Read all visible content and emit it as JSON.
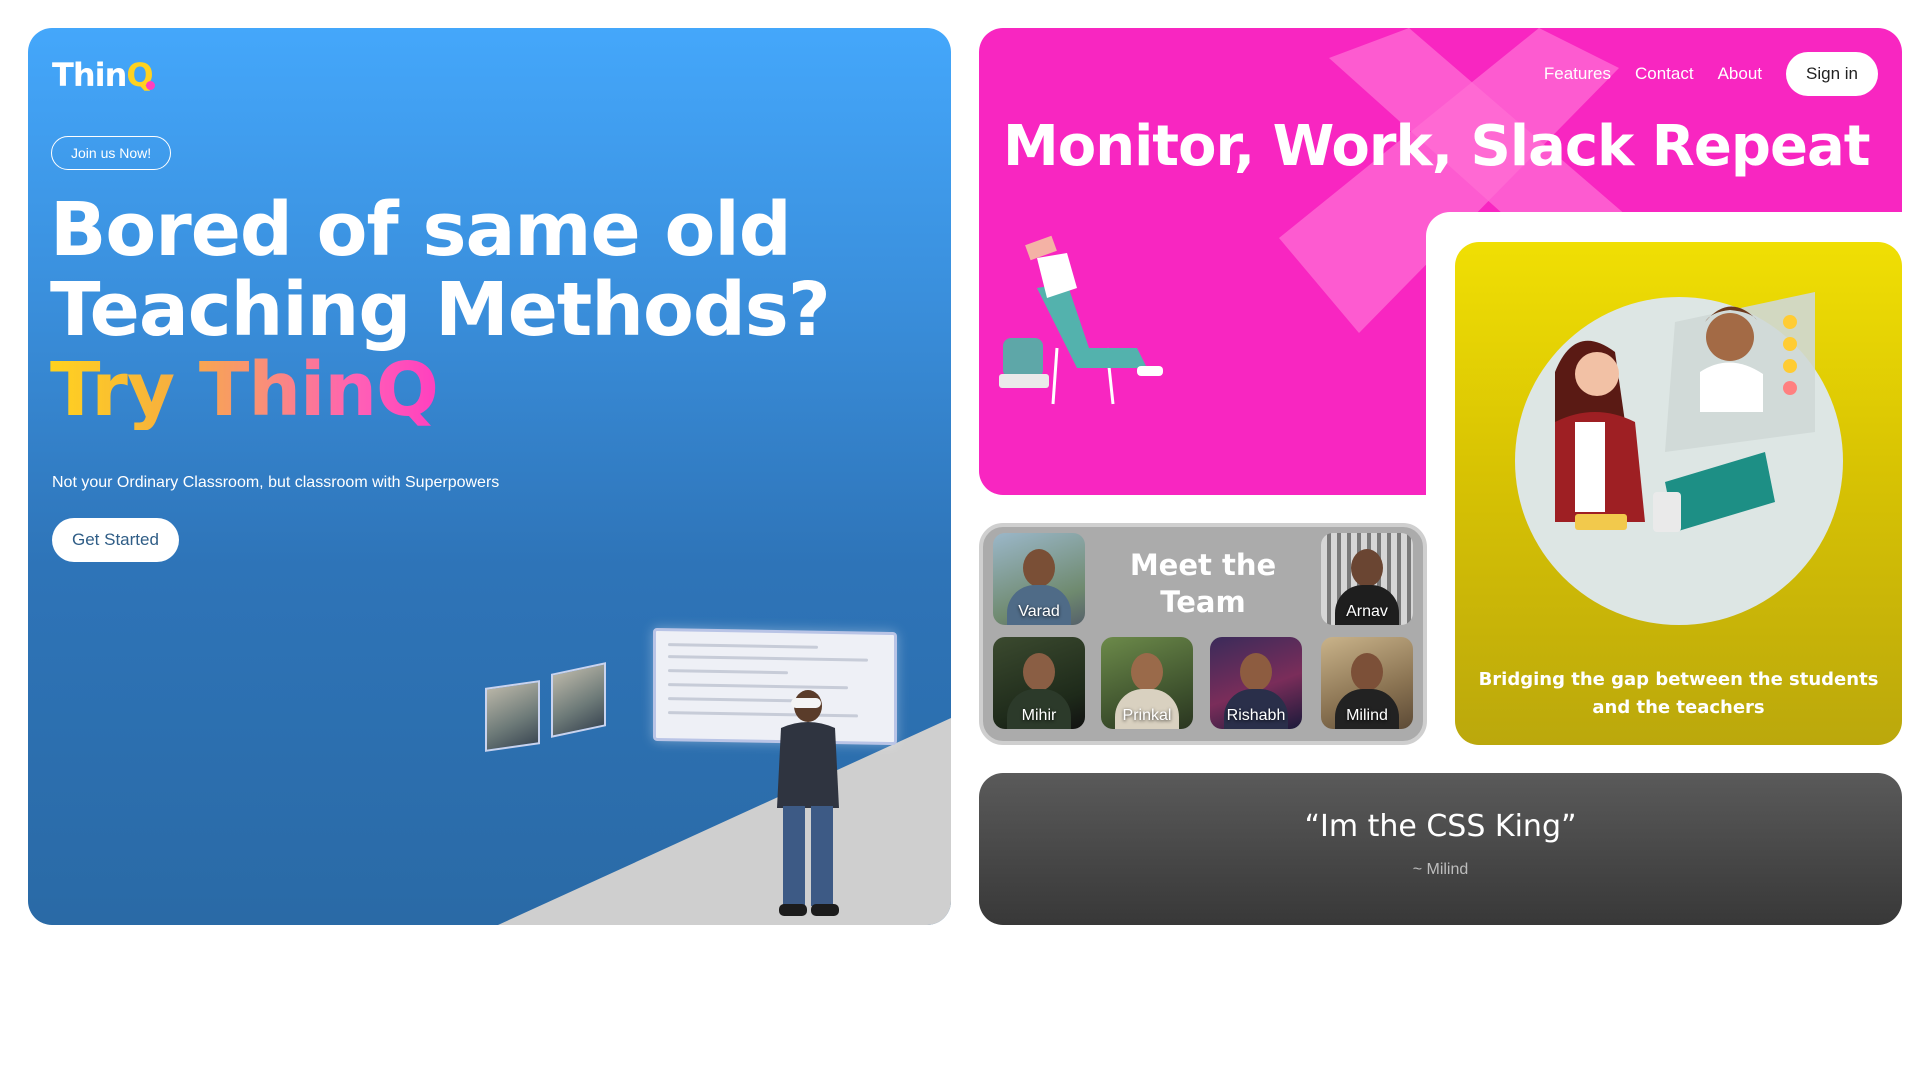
{
  "brand": {
    "logo_main": "Thin",
    "logo_q": "Q"
  },
  "hero": {
    "join_label": "Join us Now!",
    "title_line1": "Bored of same old",
    "title_line2": "Teaching Methods?",
    "try_text": "Try ThinQ",
    "subtitle": "Not your Ordinary Classroom, but classroom with Superpowers",
    "cta_label": "Get Started",
    "colors": {
      "gradient_top": "#44a7fb",
      "gradient_bottom": "#2a6aa6",
      "floor": "#cfcfcf"
    }
  },
  "nav": {
    "links": [
      "Features",
      "Contact",
      "About"
    ],
    "signin_label": "Sign in"
  },
  "magenta_card": {
    "title": "Monitor, Work, Slack Repeat",
    "color": "#f826c1"
  },
  "yellow_card": {
    "caption": "Bridging the gap between the students and the teachers",
    "color": "#e3cf04"
  },
  "team": {
    "title": "Meet the Team",
    "members": [
      "Varad",
      "Arnav",
      "Mihir",
      "Prinkal",
      "Rishabh",
      "Milind"
    ]
  },
  "quote": {
    "text": "“Im the CSS King”",
    "author": "~ Milind"
  }
}
